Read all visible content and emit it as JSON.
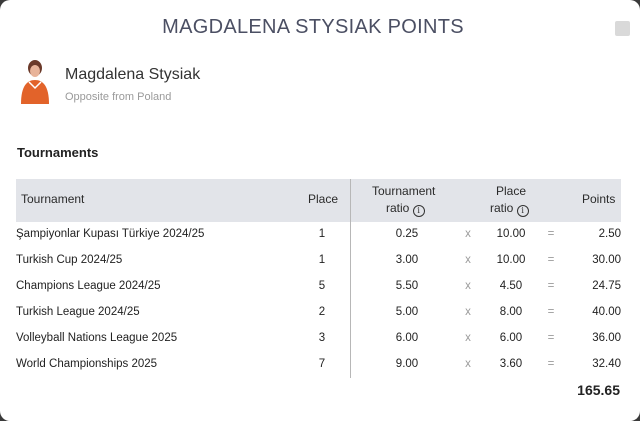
{
  "modal": {
    "title": "MAGDALENA STYSIAK POINTS"
  },
  "player": {
    "name": "Magdalena Stysiak",
    "role": "Opposite from Poland"
  },
  "section_title": "Tournaments",
  "table": {
    "headers": {
      "tournament": "Tournament",
      "place": "Place",
      "tournament_ratio_1": "Tournament",
      "tournament_ratio_2": "ratio",
      "place_ratio_1": "Place",
      "place_ratio_2": "ratio",
      "points": "Points",
      "info_glyph": "i"
    },
    "rows": [
      {
        "tournament": "Şampiyonlar Kupası Türkiye 2024/25",
        "place": "1",
        "tratio": "0.25",
        "x": "x",
        "pratio": "10.00",
        "eq": "=",
        "points": "2.50"
      },
      {
        "tournament": "Turkish Cup 2024/25",
        "place": "1",
        "tratio": "3.00",
        "x": "x",
        "pratio": "10.00",
        "eq": "=",
        "points": "30.00"
      },
      {
        "tournament": "Champions League 2024/25",
        "place": "5",
        "tratio": "5.50",
        "x": "x",
        "pratio": "4.50",
        "eq": "=",
        "points": "24.75"
      },
      {
        "tournament": "Turkish League 2024/25",
        "place": "2",
        "tratio": "5.00",
        "x": "x",
        "pratio": "8.00",
        "eq": "=",
        "points": "40.00"
      },
      {
        "tournament": "Volleyball Nations League 2025",
        "place": "3",
        "tratio": "6.00",
        "x": "x",
        "pratio": "6.00",
        "eq": "=",
        "points": "36.00"
      },
      {
        "tournament": "World Championships 2025",
        "place": "7",
        "tratio": "9.00",
        "x": "x",
        "pratio": "3.60",
        "eq": "=",
        "points": "32.40"
      }
    ],
    "total": "165.65"
  },
  "colors": {
    "header_bg": "#e2e4e9",
    "title": "#4b4f63",
    "jersey": "#e2632a"
  }
}
